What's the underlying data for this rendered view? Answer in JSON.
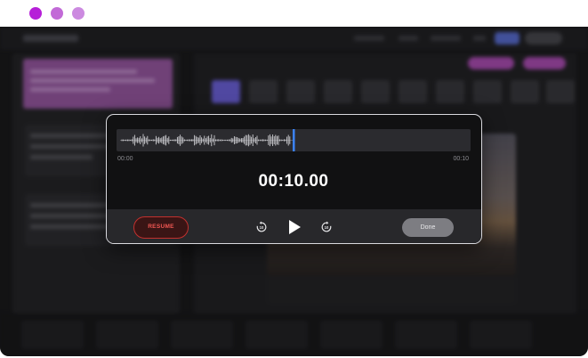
{
  "window": {
    "dots": [
      "#b61fd8",
      "#c26ad7",
      "#cc8ae0"
    ]
  },
  "recorder": {
    "waveform_icon": "waveform",
    "playhead_color": "#3b82f6",
    "time_start": "00:00",
    "time_end": "00:10",
    "timer": "00:10.00",
    "resume_label": "RESUME",
    "done_label": "Done",
    "icons": {
      "rewind": "rewind-10-icon",
      "play": "play-icon",
      "forward": "forward-10-icon"
    },
    "accent_red": "#c2302e",
    "progress": 0.5
  }
}
